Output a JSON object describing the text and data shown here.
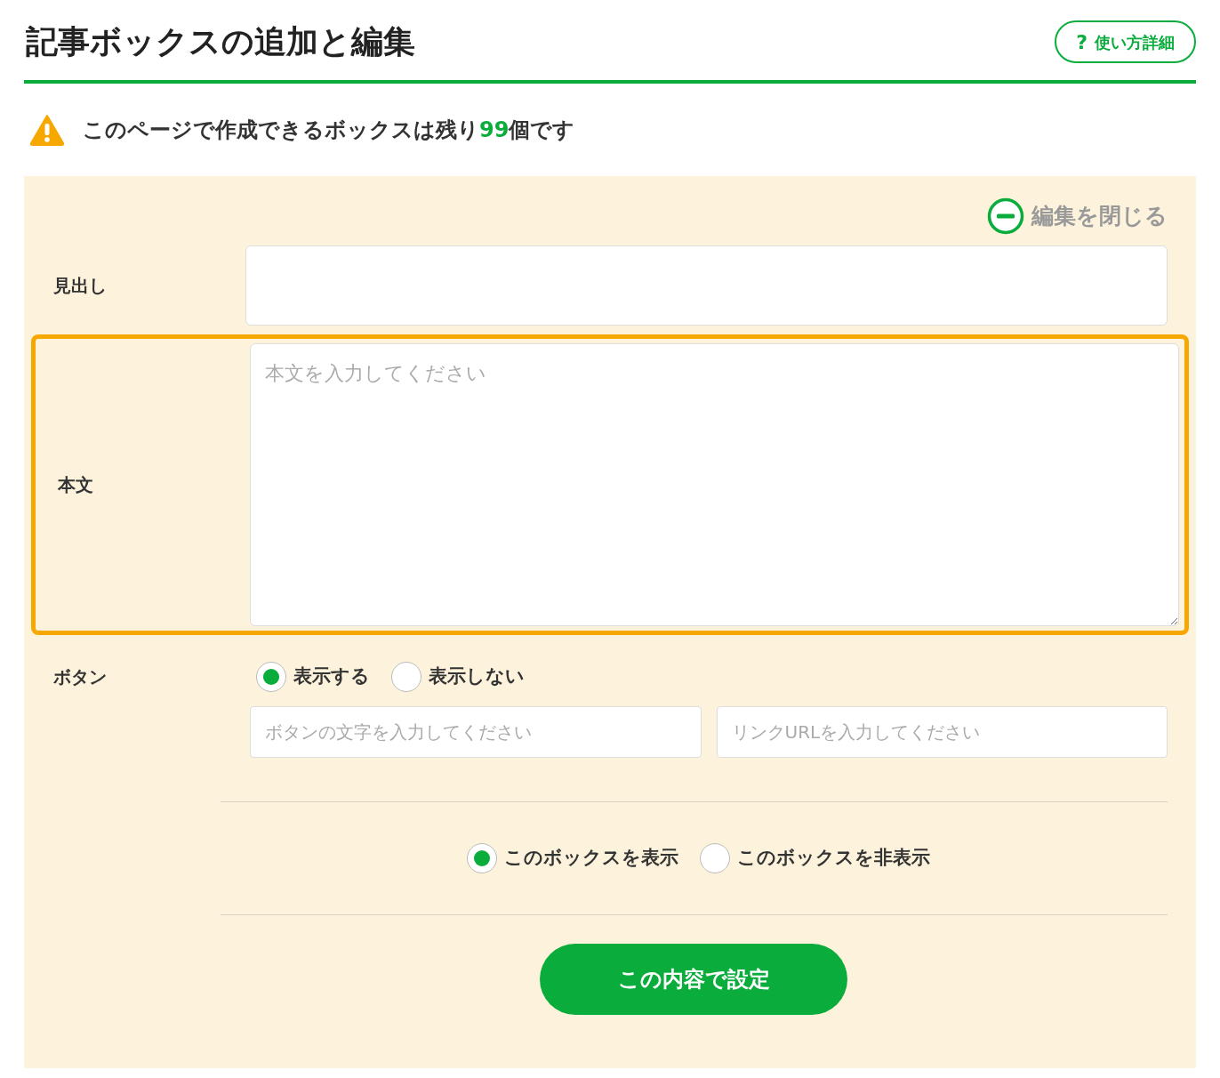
{
  "header": {
    "title": "記事ボックスの追加と編集",
    "help_button": {
      "icon_text": "?",
      "label": "使い方詳細"
    }
  },
  "notice": {
    "prefix": "このページで作成できるボックスは残り",
    "count": "99",
    "suffix": "個です"
  },
  "editor": {
    "close_label": "編集を閉じる",
    "heading": {
      "label": "見出し"
    },
    "body": {
      "label": "本文",
      "placeholder": "本文を入力してください",
      "highlighted": true
    },
    "button": {
      "label": "ボタン",
      "options": [
        {
          "label": "表示する",
          "selected": true
        },
        {
          "label": "表示しない",
          "selected": false
        }
      ],
      "inputs": [
        {
          "placeholder": "ボタンの文字を入力してください"
        },
        {
          "placeholder": "リンクURLを入力してください"
        }
      ]
    },
    "visibility": [
      {
        "label": "このボックスを表示",
        "selected": true
      },
      {
        "label": "このボックスを非表示",
        "selected": false
      }
    ],
    "submit_label": "この内容で設定"
  }
}
